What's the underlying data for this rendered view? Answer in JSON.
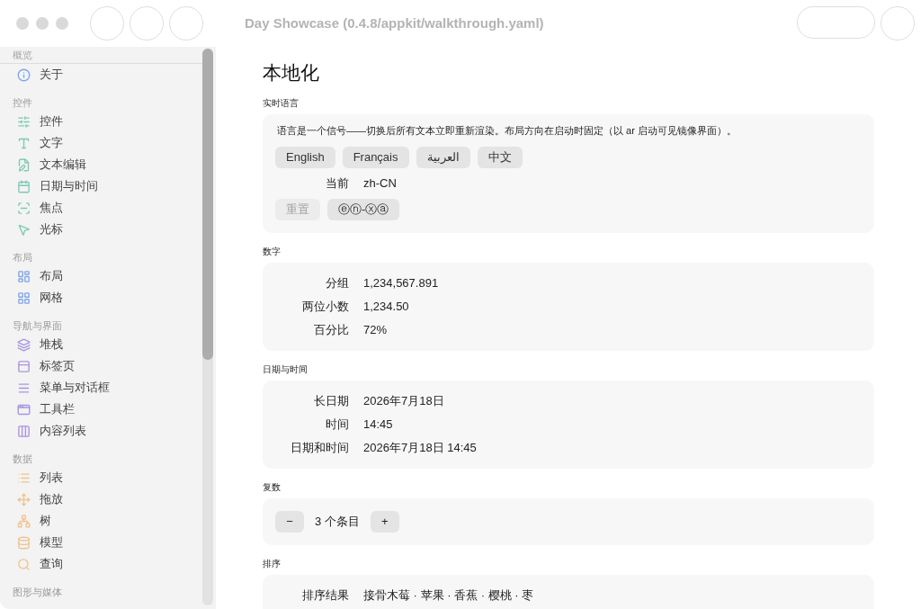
{
  "window": {
    "title": "Day Showcase (0.4.8/appkit/walkthrough.yaml)"
  },
  "sidebar": {
    "groups": [
      {
        "heading": "概览",
        "items": [
          {
            "label": "关于"
          }
        ]
      },
      {
        "heading": "控件",
        "items": [
          {
            "label": "控件"
          },
          {
            "label": "文字"
          },
          {
            "label": "文本编辑"
          },
          {
            "label": "日期与时间"
          },
          {
            "label": "焦点"
          },
          {
            "label": "光标"
          }
        ]
      },
      {
        "heading": "布局",
        "items": [
          {
            "label": "布局"
          },
          {
            "label": "网格"
          }
        ]
      },
      {
        "heading": "导航与界面",
        "items": [
          {
            "label": "堆栈"
          },
          {
            "label": "标签页"
          },
          {
            "label": "菜单与对话框"
          },
          {
            "label": "工具栏"
          },
          {
            "label": "内容列表"
          }
        ]
      },
      {
        "heading": "数据",
        "items": [
          {
            "label": "列表"
          },
          {
            "label": "拖放"
          },
          {
            "label": "树"
          },
          {
            "label": "模型"
          },
          {
            "label": "查询"
          }
        ]
      },
      {
        "heading": "图形与媒体"
      }
    ]
  },
  "page": {
    "title": "本地化",
    "sections": [
      {
        "label": "实时语言",
        "rows": [
          {
            "kind": "text",
            "text": "语言是一个信号——切换后所有文本立即重新渲染。布局方向在启动时固定（以 ar 启动可见镜像界面）。"
          },
          {
            "kind": "buttons",
            "buttons": [
              {
                "label": "English",
                "disabled": false
              },
              {
                "label": "Français",
                "disabled": false
              },
              {
                "label": "العربية",
                "disabled": false
              },
              {
                "label": "中文",
                "disabled": false
              }
            ]
          },
          {
            "kind": "field",
            "label": "当前",
            "value": "zh-CN"
          },
          {
            "kind": "buttons",
            "buttons": [
              {
                "label": "重置",
                "disabled": true
              },
              {
                "label": "ⓔⓝ-ⓧⓐ",
                "disabled": false
              }
            ]
          }
        ]
      },
      {
        "label": "数字",
        "rows": [
          {
            "kind": "field",
            "label": "分组",
            "value": "1,234,567.891"
          },
          {
            "kind": "field",
            "label": "两位小数",
            "value": "1,234.50"
          },
          {
            "kind": "field",
            "label": "百分比",
            "value": "72%"
          }
        ]
      },
      {
        "label": "日期与时间",
        "rows": [
          {
            "kind": "field",
            "label": "长日期",
            "value": "2026年7月18日"
          },
          {
            "kind": "field",
            "label": "时间",
            "value": "14:45"
          },
          {
            "kind": "field",
            "label": "日期和时间",
            "value": "2026年7月18日 14:45"
          }
        ]
      },
      {
        "label": "复数",
        "rows": [
          {
            "kind": "stepper",
            "minus": "−",
            "value": "3 个条目",
            "plus": "+"
          }
        ]
      },
      {
        "label": "排序",
        "rows": [
          {
            "kind": "field",
            "label": "排序结果",
            "value": "接骨木莓 · 苹果 · 香蕉 · 樱桃 · 枣"
          }
        ]
      }
    ]
  }
}
